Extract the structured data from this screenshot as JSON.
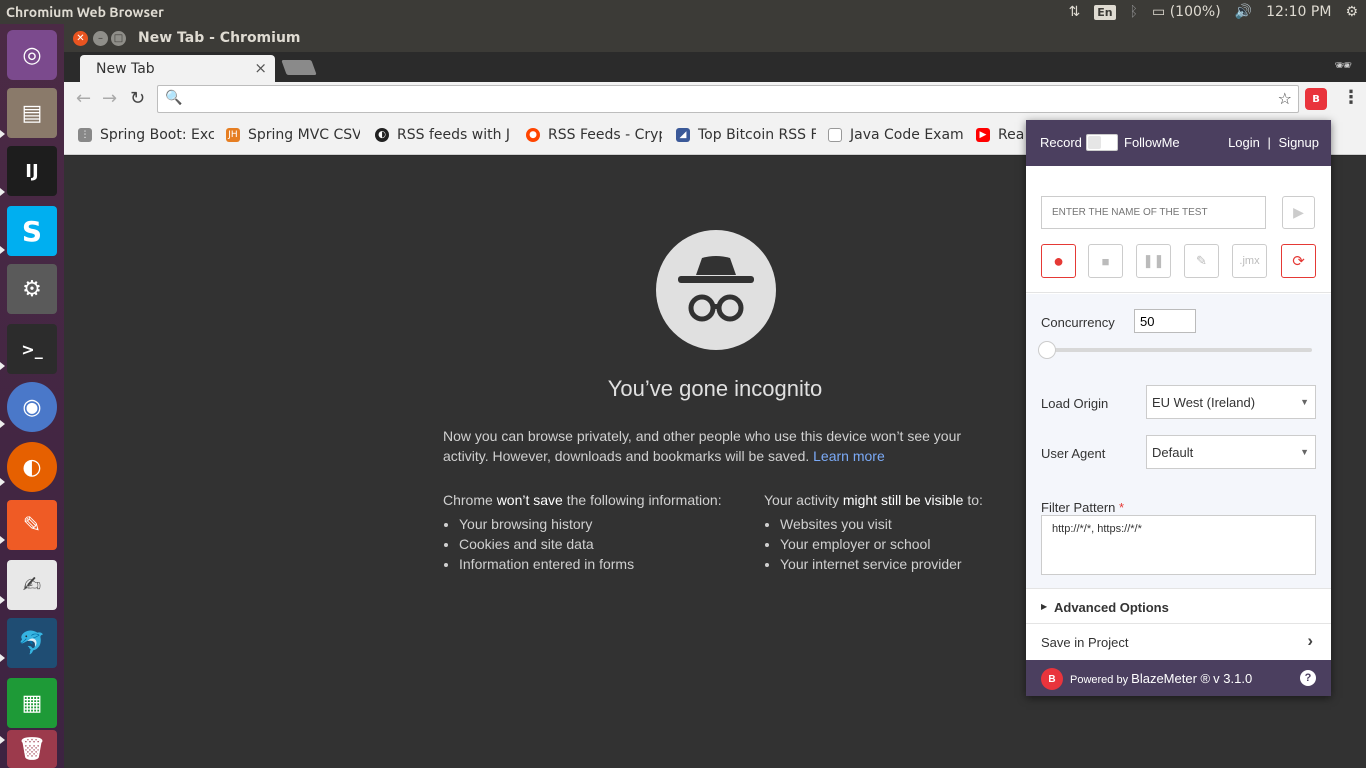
{
  "top_panel": {
    "app_title": "Chromium Web Browser",
    "keyboard": "En",
    "battery": "(100%)",
    "time": "12:10 PM"
  },
  "launcher": {
    "items": [
      "ubuntu-dash",
      "files",
      "intellij",
      "skype",
      "system-settings",
      "terminal",
      "chromium",
      "firefox",
      "postman",
      "text-editor",
      "mysql-workbench",
      "libreoffice-calc",
      "trash"
    ]
  },
  "window": {
    "title": "New Tab - Chromium",
    "tab_label": "New Tab",
    "tab_close": "×"
  },
  "omnibox": {
    "value": "",
    "placeholder": ""
  },
  "bookmarks": [
    {
      "label": "Spring Boot: Exc",
      "icon_color": "#888888"
    },
    {
      "label": "Spring MVC CSV",
      "icon_color": "#e67e22"
    },
    {
      "label": "RSS feeds with J",
      "icon_color": "#222222"
    },
    {
      "label": "RSS Feeds - Crypt",
      "icon_color": "#ff4500"
    },
    {
      "label": "Top Bitcoin RSS F",
      "icon_color": "#3b5998"
    },
    {
      "label": "Java Code Exam",
      "icon_color": "#bbbbbb"
    },
    {
      "label": "Rea",
      "icon_color": "#ff0000"
    }
  ],
  "incognito": {
    "heading": "You’ve gone incognito",
    "desc_main": "Now you can browse privately, and other people who use this device won’t see your activity. However, downloads and bookmarks will be saved.",
    "learn_more": "Learn more",
    "left_prefix": "Chrome ",
    "left_bold": "won’t save",
    "left_suffix": " the following information:",
    "left_items": [
      "Your browsing history",
      "Cookies and site data",
      "Information entered in forms"
    ],
    "right_prefix": "Your activity ",
    "right_bold": "might still be visible",
    "right_suffix": " to:",
    "right_items": [
      "Websites you visit",
      "Your employer or school",
      "Your internet service provider"
    ]
  },
  "popup": {
    "record_label": "Record",
    "followme_label": "FollowMe",
    "login": "Login",
    "separator": "|",
    "signup": "Signup",
    "test_name_placeholder": "ENTER THE NAME OF THE TEST",
    "jmx_label": ".jmx",
    "concurrency_label": "Concurrency",
    "concurrency_value": "50",
    "concurrency_slider_fraction": 0.0,
    "load_origin_label": "Load Origin",
    "load_origin_value": "EU West (Ireland)",
    "user_agent_label": "User Agent",
    "user_agent_value": "Default",
    "filter_label": "Filter Pattern",
    "filter_required": "*",
    "filter_value": "http://*/*, https://*/*",
    "advanced_options": "Advanced Options",
    "save_in_project": "Save in Project",
    "powered_by": "Powered by",
    "brand": "BlazeMeter ®",
    "version": "v 3.1.0",
    "logo_text": "B",
    "help": "?"
  },
  "colors": {
    "accent": "#e9343c",
    "popup_header": "#4b3f5f",
    "launcher": "#4b2a45"
  }
}
